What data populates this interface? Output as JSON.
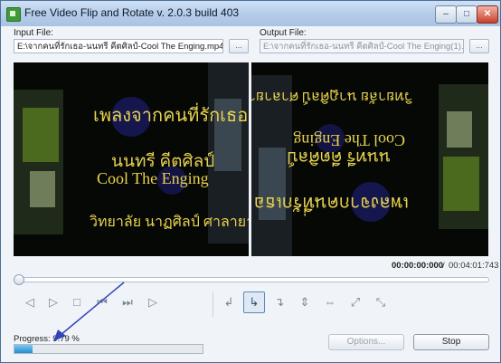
{
  "window": {
    "title": "Free Video Flip and Rotate  v. 2.0.3 build 403",
    "minimize": "–",
    "maximize": "□",
    "close": "✕"
  },
  "input": {
    "label": "Input File:",
    "value": "E:\\จากคนที่รักเธอ-นนทรี คีตศิลป์-Cool The Enging.mp4",
    "browse": "..."
  },
  "output": {
    "label": "Output File:",
    "value": "E:\\จากคนที่รักเธอ-นนทรี คีตศิลป์-Cool The Enging(1).mp4",
    "browse": "..."
  },
  "preview": {
    "line1": "เพลงจากคนที่รักเธอ",
    "line2": "นนทรี คีตศิลป์",
    "line3": "Cool The Enging",
    "line4": "วิทยาลัย นาฏศิลป์ ศาลายา"
  },
  "time": {
    "current": "00:00:00:000",
    "separator": "/",
    "total": "00:04:01:743"
  },
  "playback_icons": [
    "step-back-icon",
    "play-icon",
    "stop-icon",
    "previous-icon",
    "next-icon",
    "forward-icon"
  ],
  "transform_icons": [
    "rotate-left-icon",
    "rotate-right-icon",
    "rotate-180-icon",
    "flip-vertical-icon",
    "flip-horizontal-icon",
    "diagonal-icon",
    "anti-diagonal-icon"
  ],
  "progress": {
    "label": "Progress: 9.79 %",
    "value": 0.0979
  },
  "buttons": {
    "options": "Options...",
    "stop": "Stop"
  }
}
